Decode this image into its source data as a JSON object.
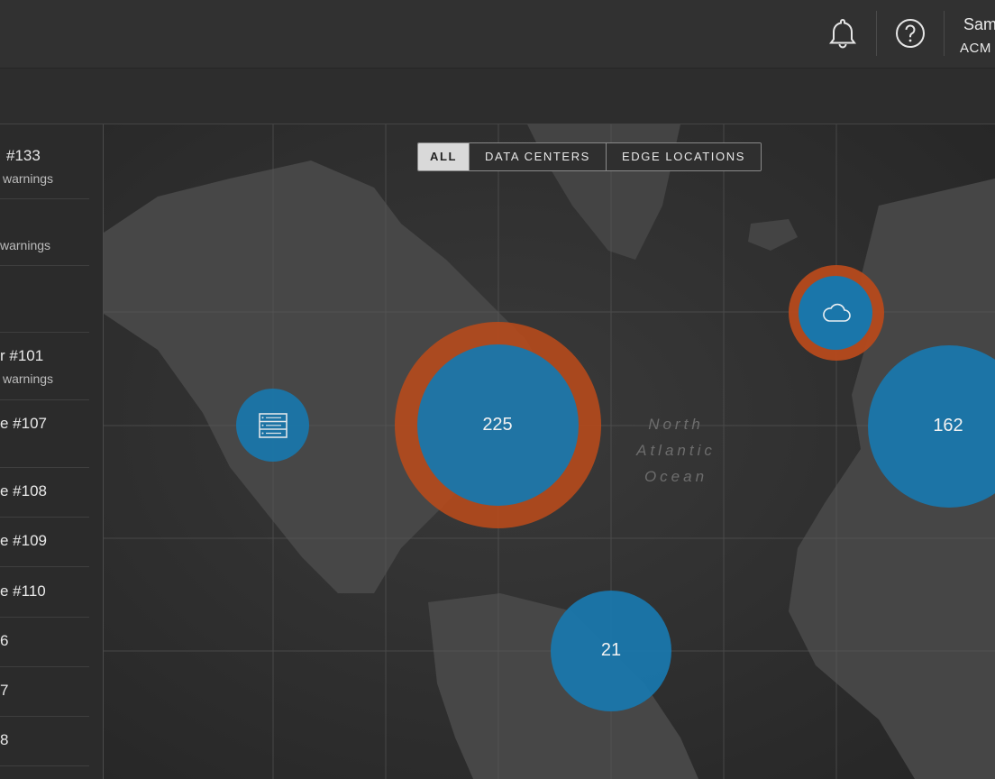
{
  "header": {
    "notifications_icon": "bell-icon",
    "help_icon": "question-circle-icon",
    "user_name": "Sam",
    "user_org": "ACM"
  },
  "sidebar": {
    "items": [
      {
        "title": "#133",
        "subtitle": "warnings"
      },
      {
        "title": "",
        "subtitle": "warnings"
      },
      {
        "title": "",
        "subtitle": ""
      },
      {
        "title": "r #101",
        "subtitle": "warnings"
      },
      {
        "title": "e #107",
        "subtitle": ""
      },
      {
        "title": "e #108",
        "subtitle": ""
      },
      {
        "title": "e #109",
        "subtitle": ""
      },
      {
        "title": "e #110",
        "subtitle": ""
      },
      {
        "title": "6",
        "subtitle": ""
      },
      {
        "title": "7",
        "subtitle": ""
      },
      {
        "title": "8",
        "subtitle": ""
      }
    ]
  },
  "map": {
    "filters": [
      {
        "label": "ALL",
        "active": true
      },
      {
        "label": "DATA CENTERS",
        "active": false
      },
      {
        "label": "EDGE LOCATIONS",
        "active": false
      }
    ],
    "ocean_label": [
      "North",
      "Atlantic",
      "Ocean"
    ],
    "markers": [
      {
        "kind": "server",
        "icon": "server-icon",
        "label": ""
      },
      {
        "kind": "cluster",
        "label": "225",
        "alert": true
      },
      {
        "kind": "cloud",
        "icon": "cloud-icon",
        "label": "",
        "alert": true
      },
      {
        "kind": "cluster",
        "label": "162",
        "alert": false
      },
      {
        "kind": "cluster",
        "label": "21",
        "alert": false
      }
    ],
    "colors": {
      "marker": "#1a76aa",
      "alert_ring": "#c2501e",
      "land": "#444444",
      "water": "#313131"
    }
  }
}
